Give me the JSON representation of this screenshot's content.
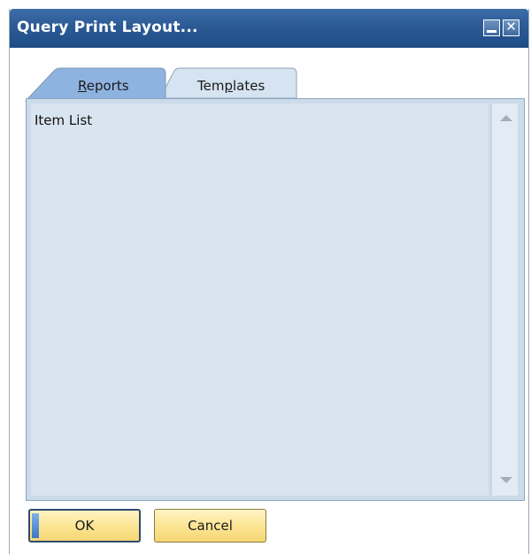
{
  "window": {
    "title": "Query Print Layout..."
  },
  "title_buttons": {
    "minimize_icon": "minimize-icon",
    "close_icon": "close-icon",
    "close_glyph": "✕"
  },
  "tabs": [
    {
      "label_underlined": "R",
      "label_rest": "eports",
      "active": true
    },
    {
      "label_before": "Tem",
      "label_underlined": "p",
      "label_after": "lates",
      "active": false
    }
  ],
  "list": {
    "items": [
      "Item List"
    ]
  },
  "buttons": {
    "ok_label": "OK",
    "cancel_label": "Cancel"
  },
  "colors": {
    "title_bar": "#2b5a95",
    "active_tab": "#8fb3e1",
    "inactive_tab": "#d6e3f1",
    "panel": "#d9e4f1",
    "button": "#fbe491"
  }
}
